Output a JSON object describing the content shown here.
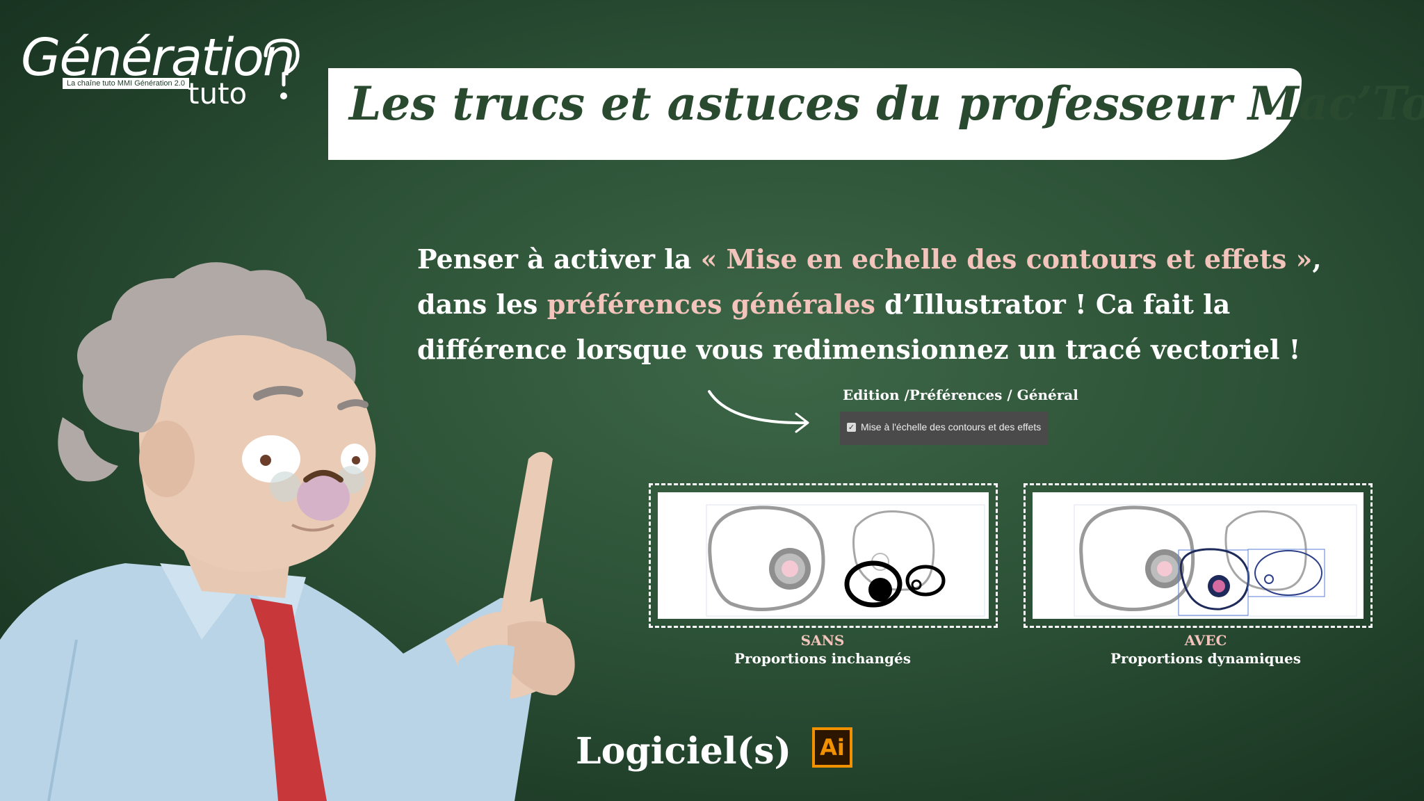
{
  "logo": {
    "line1": "Génération",
    "line2": "tuto",
    "tagline": "La chaîne tuto MMI Génération 2.0"
  },
  "banner": {
    "title": "Les trucs et astuces du professeur Mac’Tosh"
  },
  "main": {
    "p1": "Penser à activer la ",
    "h1": "« Mise en echelle des contours et effets »",
    "p2": ",",
    "p3": "dans les ",
    "h2": "préférences générales",
    "p4": " d’Illustrator ! Ca fait la",
    "p5": "différence lorsque vous redimensionnez un tracé vectoriel !"
  },
  "preferences": {
    "path": "Edition /Préférences / Général",
    "checkbox_label": "Mise à l'échelle des contours et des effets",
    "checked": true
  },
  "comparison": [
    {
      "title": "SANS",
      "subtitle": "Proportions inchangés"
    },
    {
      "title": "AVEC",
      "subtitle": "Proportions dynamiques"
    }
  ],
  "software": {
    "label": "Logiciel(s)",
    "icon": "illustrator-icon",
    "icon_text": "Ai"
  },
  "colors": {
    "background": "#2c5136",
    "highlight": "#f2c4bb",
    "banner_text": "#2a4a30",
    "ai_orange": "#f29100"
  }
}
